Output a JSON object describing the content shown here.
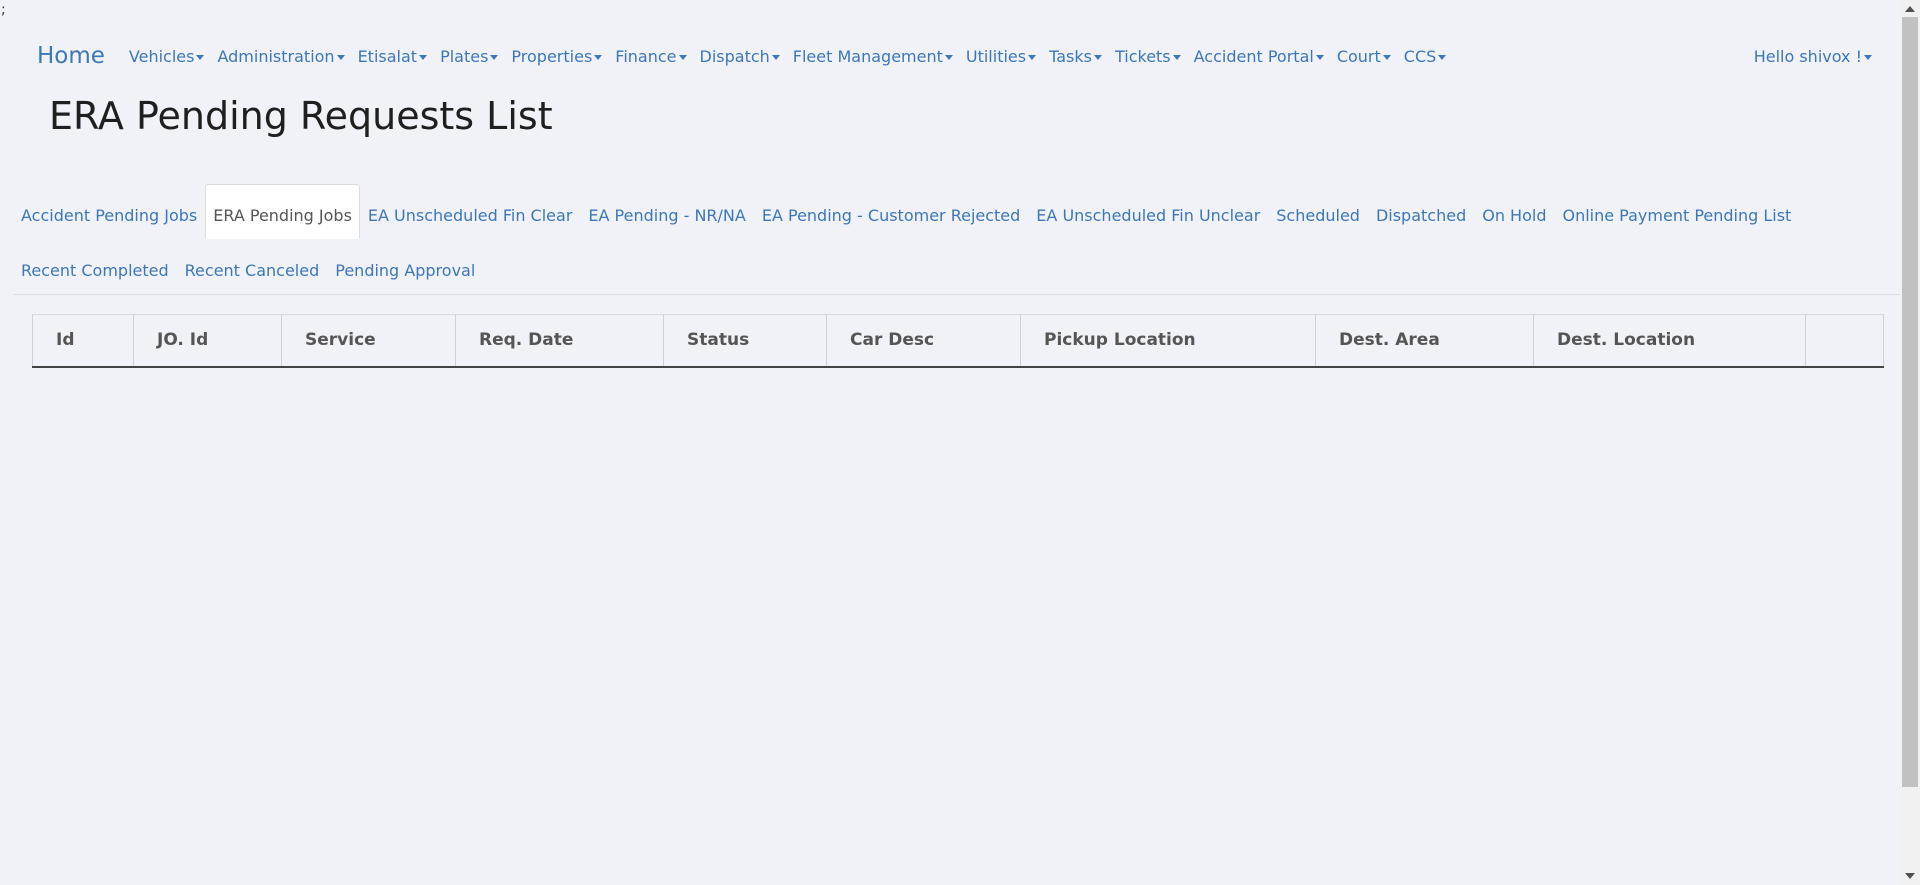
{
  "stray_text": ";",
  "navbar": {
    "brand": "Home",
    "items": [
      {
        "label": "Vehicles"
      },
      {
        "label": "Administration"
      },
      {
        "label": "Etisalat"
      },
      {
        "label": "Plates"
      },
      {
        "label": "Properties"
      },
      {
        "label": "Finance"
      },
      {
        "label": "Dispatch"
      },
      {
        "label": "Fleet Management"
      },
      {
        "label": "Utilities"
      },
      {
        "label": "Tasks"
      },
      {
        "label": "Tickets"
      },
      {
        "label": "Accident Portal"
      },
      {
        "label": "Court"
      },
      {
        "label": "CCS"
      }
    ],
    "user_greeting": "Hello shivox !"
  },
  "page": {
    "title": "ERA Pending Requests List"
  },
  "tabs": [
    {
      "label": "Accident Pending Jobs",
      "active": false
    },
    {
      "label": "ERA Pending Jobs",
      "active": true
    },
    {
      "label": "EA Unscheduled Fin Clear",
      "active": false
    },
    {
      "label": "EA Pending - NR/NA",
      "active": false
    },
    {
      "label": "EA Pending - Customer Rejected",
      "active": false
    },
    {
      "label": "EA Unscheduled Fin Unclear",
      "active": false
    },
    {
      "label": "Scheduled",
      "active": false
    },
    {
      "label": "Dispatched",
      "active": false
    },
    {
      "label": "On Hold",
      "active": false
    },
    {
      "label": "Online Payment Pending List",
      "active": false
    },
    {
      "label": "Recent Completed",
      "active": false
    },
    {
      "label": "Recent Canceled",
      "active": false
    },
    {
      "label": "Pending Approval",
      "active": false
    }
  ],
  "table": {
    "columns": [
      {
        "label": "Id"
      },
      {
        "label": "JO. Id"
      },
      {
        "label": "Service"
      },
      {
        "label": "Req. Date"
      },
      {
        "label": "Status"
      },
      {
        "label": "Car Desc"
      },
      {
        "label": "Pickup Location"
      },
      {
        "label": "Dest. Area"
      },
      {
        "label": "Dest. Location"
      },
      {
        "label": ""
      }
    ],
    "rows": []
  },
  "colors": {
    "link": "#3d77b8",
    "background": "#f1f2f7",
    "title": "#1f1f1f",
    "header_text": "#555555"
  }
}
